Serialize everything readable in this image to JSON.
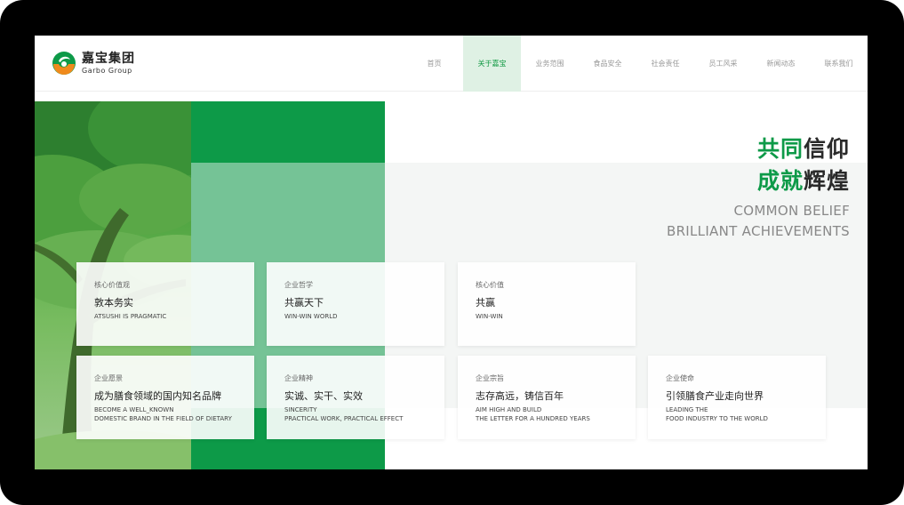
{
  "brand": {
    "name_cn": "嘉宝集团",
    "name_en": "Garbo Group",
    "colors": {
      "primary": "#0d9a48",
      "accent": "#f08a1c",
      "nav_active_bg": "#dff1e4"
    }
  },
  "nav": {
    "items": [
      {
        "label": "首页",
        "active": false
      },
      {
        "label": "关于嘉宝",
        "active": true
      },
      {
        "label": "业务范围",
        "active": false
      },
      {
        "label": "食品安全",
        "active": false
      },
      {
        "label": "社会责任",
        "active": false
      },
      {
        "label": "员工风采",
        "active": false
      },
      {
        "label": "新闻动态",
        "active": false
      },
      {
        "label": "联系我们",
        "active": false
      }
    ]
  },
  "hero": {
    "line1_green": "共同",
    "line1_dark": "信仰",
    "line2_green": "成就",
    "line2_dark": "辉煌",
    "en_line1": "COMMON BELIEF",
    "en_line2": "BRILLIANT ACHIEVEMENTS"
  },
  "cards": [
    {
      "label": "核心价值观",
      "title": "敦本务实",
      "en_line1": "ATSUSHI IS PRAGMATIC",
      "en_line2": ""
    },
    {
      "label": "企业哲学",
      "title": "共赢天下",
      "en_line1": "WIN-WIN WORLD",
      "en_line2": ""
    },
    {
      "label": "核心价值",
      "title": "共赢",
      "en_line1": "WIN-WIN",
      "en_line2": ""
    },
    {
      "label": "企业愿景",
      "title": "成为膳食领域的国内知名品牌",
      "en_line1": "BECOME A WELL_KNOWN",
      "en_line2": "DOMESTIC BRAND IN THE FIELD OF DIETARY"
    },
    {
      "label": "企业精神",
      "title": "实诚、实干、实效",
      "en_line1": "SINCERITY",
      "en_line2": "PRACTICAL WORK, PRACTICAL EFFECT"
    },
    {
      "label": "企业宗旨",
      "title": "志存高远，铸信百年",
      "en_line1": "AIM HIGH AND BUILD",
      "en_line2": "THE LETTER FOR A HUNDRED YEARS"
    },
    {
      "label": "企业使命",
      "title": "引领膳食产业走向世界",
      "en_line1": "LEADING THE",
      "en_line2": "FOOD INDUSTRY TO THE WORLD"
    }
  ]
}
